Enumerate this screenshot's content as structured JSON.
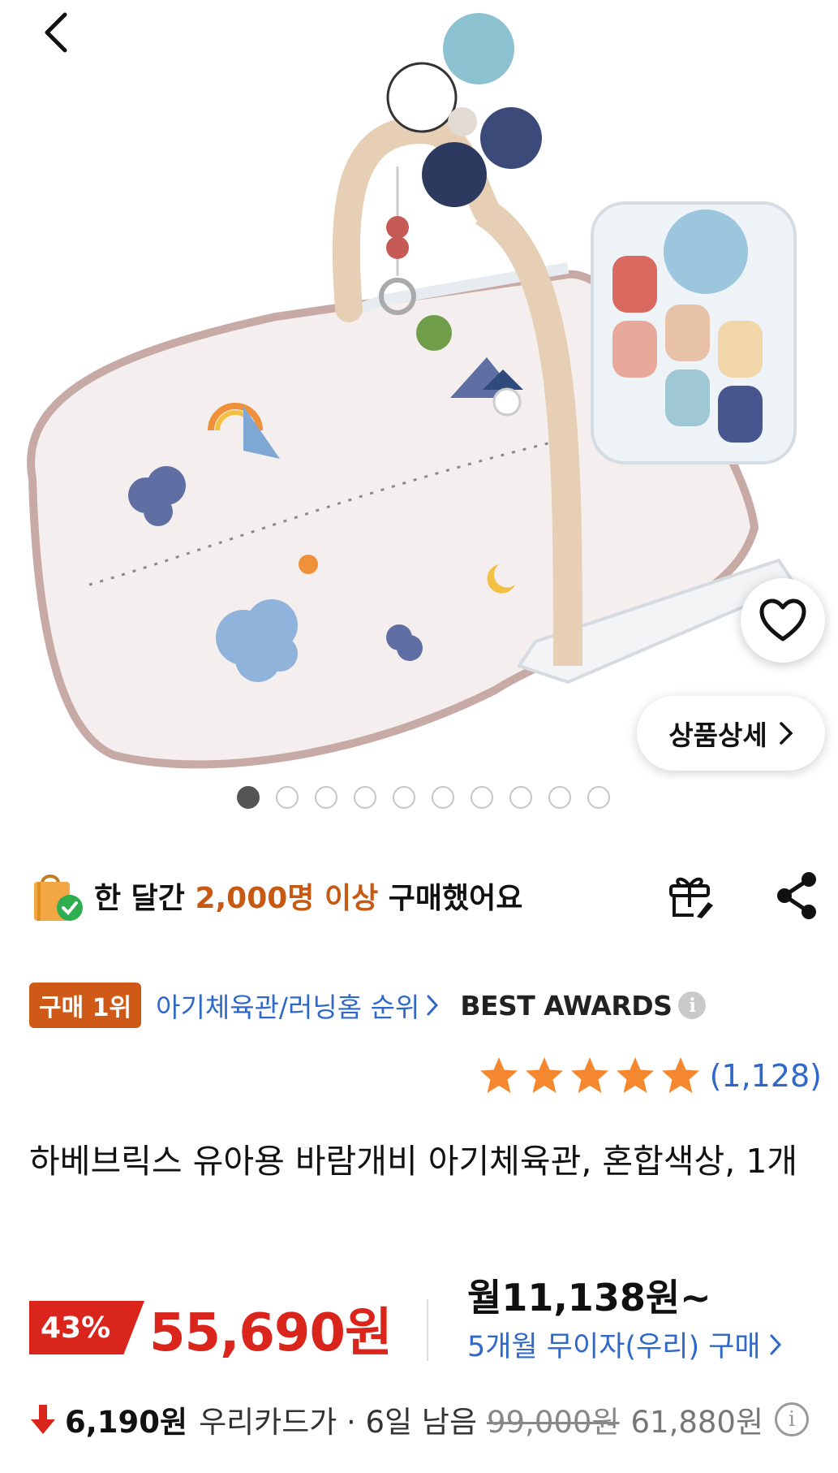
{
  "gallery": {
    "image_alt": "baby play gym product image",
    "detail_button_label": "상품상세",
    "dot_count": 10,
    "active_index": 0
  },
  "purchase_stat": {
    "prefix": "한 달간 ",
    "highlight": "2,000명 이상",
    "suffix": " 구매했어요"
  },
  "rank": {
    "badge": "구매 1위",
    "category_link": "아기체육관/러닝홈 순위",
    "awards": "BEST AWARDS"
  },
  "rating": {
    "stars": 5,
    "review_count": "(1,128)"
  },
  "product": {
    "title": "하베브릭스 유아용 바람개비 아기체육관, 혼합색상, 1개"
  },
  "price": {
    "discount_rate": "43%",
    "sale_price": "55,690원",
    "monthly": "월11,138원~",
    "installment": "5개월 무이자(우리) 구매"
  },
  "card_discount": {
    "amount": "6,190원",
    "text": "우리카드가 · 6일 남음",
    "original_price": "99,000원",
    "final_price": "61,880원"
  },
  "colors": {
    "accent_orange": "#cf5a17",
    "price_red": "#d9251b",
    "link_blue": "#2f68c9",
    "star_orange": "#f5872e"
  },
  "icons": [
    "back-icon",
    "heart-icon",
    "chevron-right-icon",
    "shopping-bag-check-icon",
    "gift-icon",
    "share-icon",
    "info-icon",
    "star-icon",
    "down-arrow-icon"
  ]
}
